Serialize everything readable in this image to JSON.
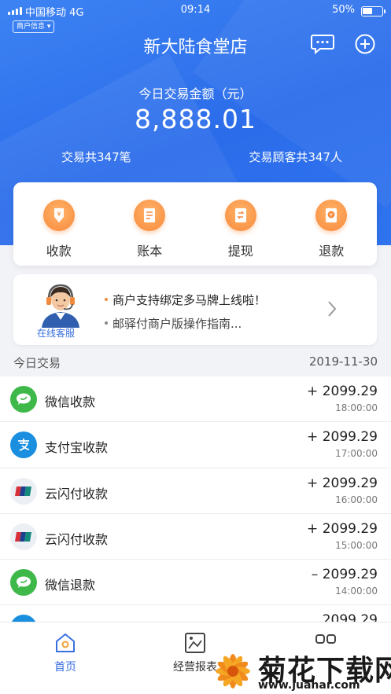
{
  "status_bar": {
    "carrier": "中国移动 4G",
    "time": "09:14",
    "battery": "50%",
    "battery_level": 0.5
  },
  "header": {
    "merchant_info_label": "商户信息 ▾",
    "shop_name": "新大陆食堂店",
    "message_icon": "chat-bubble-icon",
    "add_icon": "plus-circle-icon"
  },
  "summary": {
    "amount_label": "今日交易金额（元）",
    "amount": "8,888.01",
    "transactions_text": "交易共347笔",
    "customers_text": "交易顾客共347人"
  },
  "actions": [
    {
      "label": "收款",
      "icon": "yuan-receive-icon"
    },
    {
      "label": "账本",
      "icon": "ledger-icon"
    },
    {
      "label": "提现",
      "icon": "withdraw-icon"
    },
    {
      "label": "退款",
      "icon": "refund-icon"
    }
  ],
  "support": {
    "agent_label": "在线客服",
    "notices": [
      "商户支持绑定多马牌上线啦！",
      "邮驿付商户版操作指南..."
    ]
  },
  "today": {
    "title": "今日交易",
    "date": "2019-11-30"
  },
  "transactions": [
    {
      "name": "微信收款",
      "amount": "+ 2099.29",
      "time": "18:00:00",
      "icon": "wechat-icon"
    },
    {
      "name": "支付宝收款",
      "amount": "+ 2099.29",
      "time": "17:00:00",
      "icon": "alipay-icon"
    },
    {
      "name": "云闪付收款",
      "amount": "+ 2099.29",
      "time": "16:00:00",
      "icon": "unionpay-icon"
    },
    {
      "name": "云闪付收款",
      "amount": "+ 2099.29",
      "time": "15:00:00",
      "icon": "unionpay-icon"
    },
    {
      "name": "微信退款",
      "amount": "– 2099.29",
      "time": "14:00:00",
      "icon": "wechat-icon"
    },
    {
      "name": "",
      "amount": "2099.29",
      "time": "",
      "icon": "alipay-icon"
    }
  ],
  "tabbar": {
    "home": "首页",
    "report": "经营报表",
    "more_icon": "more-grid-icon"
  },
  "watermark": {
    "title": "菊花下载网",
    "url": "www.juahar.com"
  },
  "colors": {
    "primary": "#2f6fec",
    "accent_orange": "#f7893a",
    "wechat_green": "#3fb84a",
    "alipay_blue": "#1a8fdf",
    "unionpay_red": "#d6303b"
  }
}
